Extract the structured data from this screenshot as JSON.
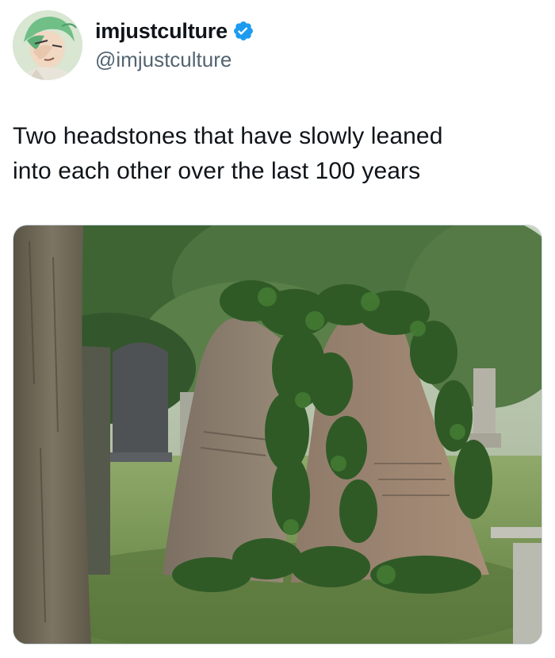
{
  "author": {
    "display_name": "imjustculture",
    "handle": "@imjustculture",
    "verified": true,
    "avatar_icon": "anime-character-avatar-icon",
    "verified_color": "#1d9bf0"
  },
  "tweet": {
    "text_lines": [
      "Two headstones that have slowly leaned",
      "into each other over the last 100 years"
    ]
  },
  "media": {
    "subject": "two ivy-covered headstones leaning into each other in a cemetery"
  }
}
